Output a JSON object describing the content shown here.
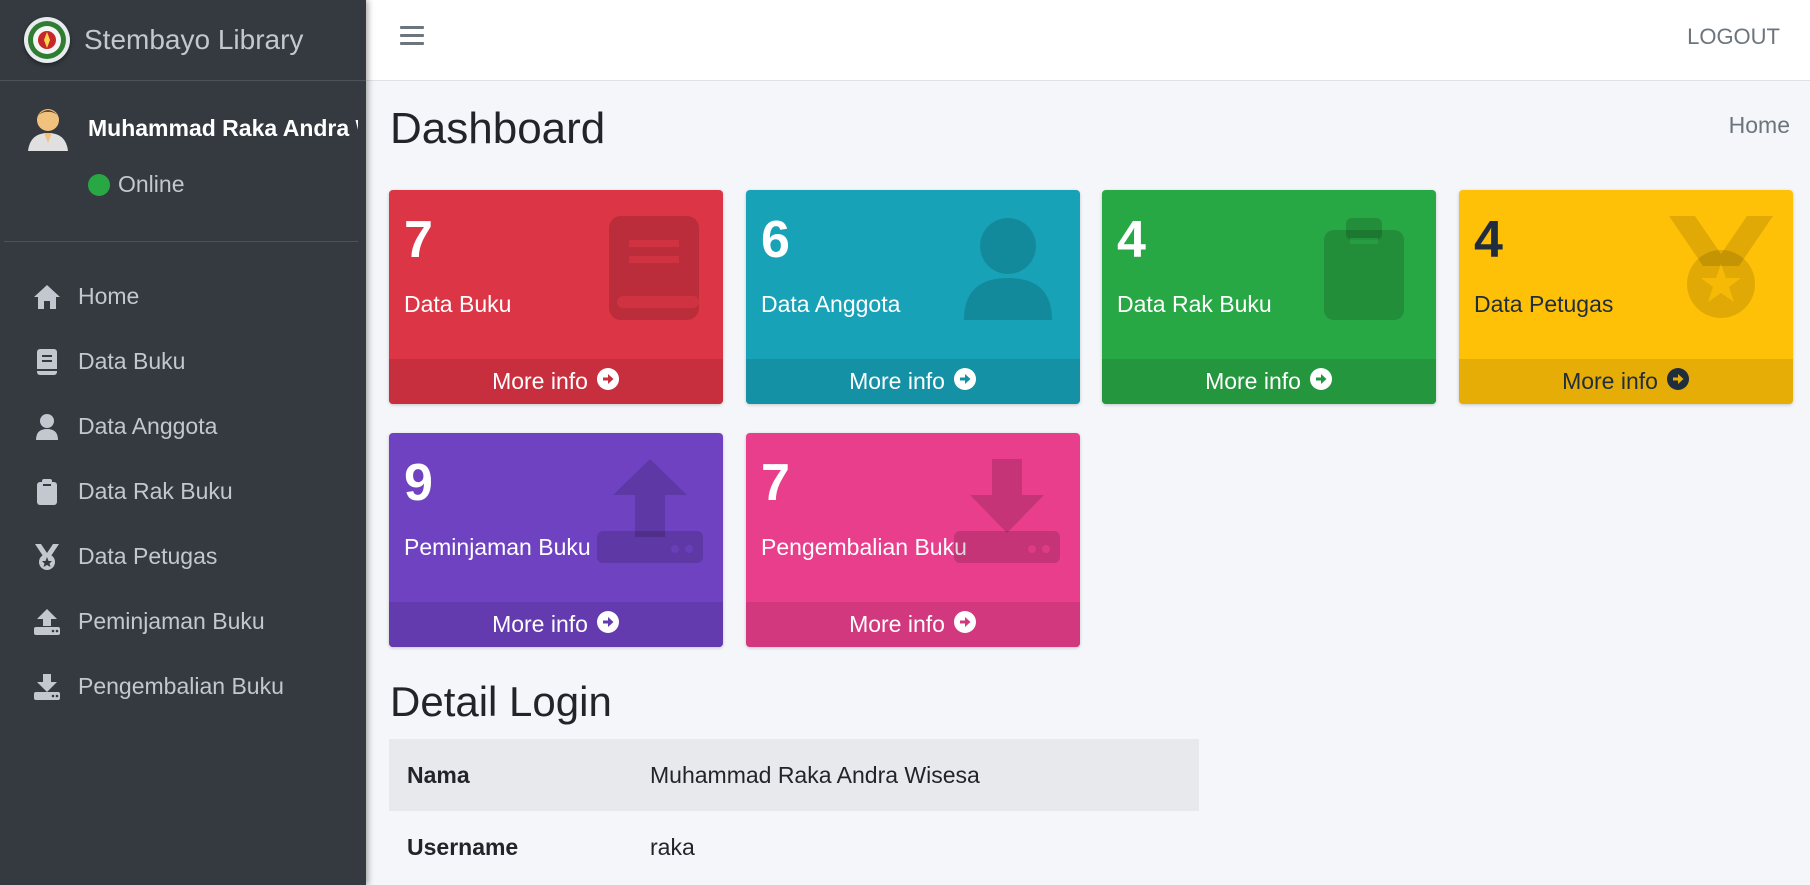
{
  "brand": {
    "title": "Stembayo Library"
  },
  "user": {
    "name": "Muhammad Raka Andra Wisesa",
    "status": "Online"
  },
  "nav": [
    {
      "label": "Home",
      "icon": "home-icon"
    },
    {
      "label": "Data Buku",
      "icon": "book-icon"
    },
    {
      "label": "Data Anggota",
      "icon": "user-icon"
    },
    {
      "label": "Data Rak Buku",
      "icon": "clipboard-icon"
    },
    {
      "label": "Data Petugas",
      "icon": "medal-icon"
    },
    {
      "label": "Peminjaman Buku",
      "icon": "upload-icon"
    },
    {
      "label": "Pengembalian Buku",
      "icon": "download-icon"
    }
  ],
  "header": {
    "logout": "LOGOUT"
  },
  "page": {
    "title": "Dashboard",
    "breadcrumb": "Home"
  },
  "boxes": [
    {
      "count": "7",
      "label": "Data Buku",
      "footer": "More info",
      "color": "#dc3545",
      "icon": "book-icon"
    },
    {
      "count": "6",
      "label": "Data Anggota",
      "footer": "More info",
      "color": "#17a2b8",
      "icon": "user-icon"
    },
    {
      "count": "4",
      "label": "Data Rak Buku",
      "footer": "More info",
      "color": "#28a745",
      "icon": "clipboard-icon"
    },
    {
      "count": "4",
      "label": "Data Petugas",
      "footer": "More info",
      "color": "#ffc107",
      "icon": "medal-icon"
    },
    {
      "count": "9",
      "label": "Peminjaman Buku",
      "footer": "More info",
      "color": "#6f42c1",
      "icon": "upload-icon"
    },
    {
      "count": "7",
      "label": "Pengembalian Buku",
      "footer": "More info",
      "color": "#e83e8c",
      "icon": "download-icon"
    }
  ],
  "detail": {
    "title": "Detail Login",
    "rows": [
      {
        "key": "Nama",
        "value": "Muhammad Raka Andra Wisesa"
      },
      {
        "key": "Username",
        "value": "raka"
      }
    ]
  }
}
